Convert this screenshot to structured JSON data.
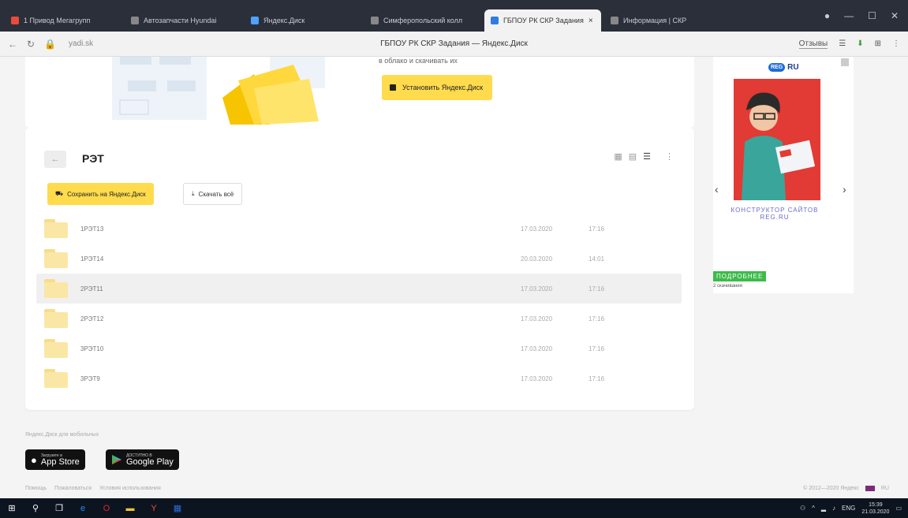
{
  "browser": {
    "tabs": [
      {
        "label": "1 Привод Мегагрупп",
        "color": "#e74c3c",
        "active": false
      },
      {
        "label": "Автозапчасти Hyundai",
        "color": "#888888",
        "active": false
      },
      {
        "label": "Яндекс.Диск",
        "color": "#4da3ff",
        "active": false
      },
      {
        "label": "Симферопольский колл",
        "color": "#888888",
        "active": false
      },
      {
        "label": "ГБПОУ РК СКР Задания",
        "color": "#2f7de1",
        "active": true
      },
      {
        "label": "Информация | СКР",
        "color": "#888888",
        "active": false
      }
    ],
    "tab_close": "×",
    "url": "yadi.sk",
    "title": "ГБПОУ РК СКР Задания — Яндекс.Диск",
    "reviews": "Отзывы"
  },
  "promo": {
    "text": "в облако и скачивать их",
    "install_label": "Установить Яндекс.Диск"
  },
  "folder": {
    "back": "←",
    "title": "РЭТ",
    "save_label": "Сохранить на Яндекс.Диск",
    "download_label": "Скачать всё",
    "files": [
      {
        "name": "1РЭТ13",
        "date": "17.03.2020",
        "time": "17:16"
      },
      {
        "name": "1РЭТ14",
        "date": "20.03.2020",
        "time": "14:01"
      },
      {
        "name": "2РЭТ11",
        "date": "17.03.2020",
        "time": "17:16"
      },
      {
        "name": "2РЭТ12",
        "date": "17.03.2020",
        "time": "17:16"
      },
      {
        "name": "3РЭТ10",
        "date": "17.03.2020",
        "time": "17:16"
      },
      {
        "name": "3РЭТ9",
        "date": "17.03.2020",
        "time": "17:16"
      }
    ]
  },
  "ad": {
    "logo_badge": "REG",
    "logo_text": "RU",
    "text": "КОНСТРУКТОР САЙТОВ REG.RU",
    "more": "ПОДРОБНЕЕ",
    "sub": "2 скачивания"
  },
  "footer": {
    "text": "Яндекс.Диск для мобильных",
    "appstore_small": "Загрузите в",
    "appstore_big": "App Store",
    "gplay_small": "ДОСТУПНО В",
    "gplay_big": "Google Play",
    "links": [
      "Помощь",
      "Пожаловаться",
      "Условия использования"
    ],
    "copyright": "© 2012—2020 Яндекс",
    "lang": "RU"
  },
  "taskbar": {
    "time": "15:39",
    "date": "21.03.2020",
    "lang": "ENG"
  }
}
